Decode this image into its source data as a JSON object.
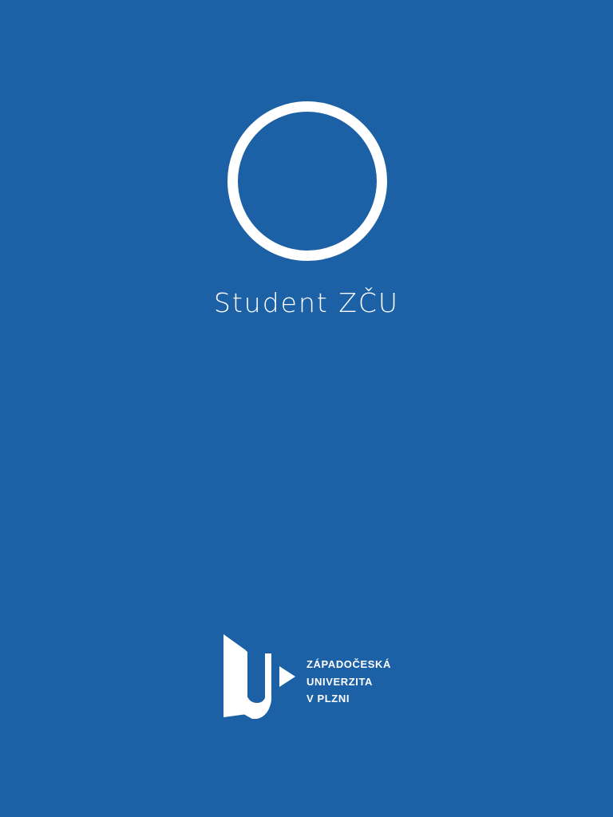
{
  "colors": {
    "background": "#1c60a6",
    "foreground": "#ffffff"
  },
  "splash": {
    "icon": "ring-icon",
    "app_name": "Student ZČU"
  },
  "university_logo": {
    "icon": "zcu-logo-mark",
    "lines": [
      "ZÁPADOČESKÁ",
      "UNIVERZITA",
      "V PLZNI"
    ]
  }
}
